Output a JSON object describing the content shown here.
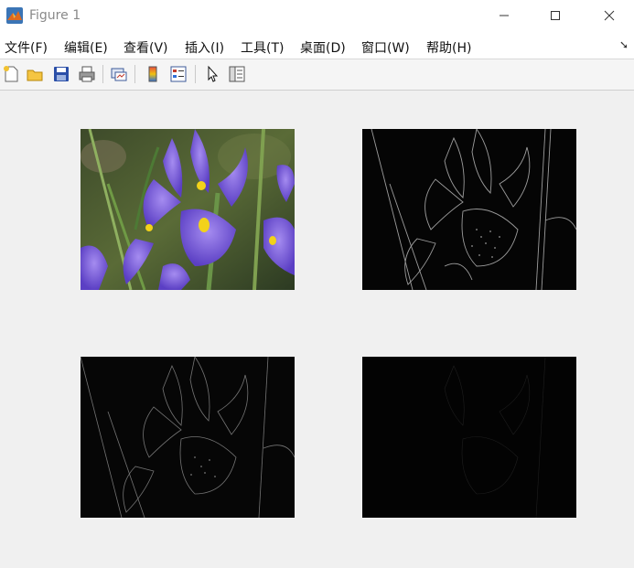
{
  "window": {
    "title": "Figure 1",
    "icon": "matlab-icon",
    "controls": [
      "minimize-icon",
      "maximize-icon",
      "close-icon"
    ]
  },
  "menu": {
    "items": [
      "文件(F)",
      "编辑(E)",
      "查看(V)",
      "插入(I)",
      "工具(T)",
      "桌面(D)",
      "窗口(W)",
      "帮助(H)"
    ],
    "overflow_icon": "dock-arrow-icon"
  },
  "toolbar": {
    "buttons": [
      "new-figure-icon",
      "open-file-icon",
      "save-icon",
      "print-icon",
      "link-plot-icon",
      "colorbar-icon",
      "legend-icon",
      "pointer-icon",
      "property-editor-icon"
    ]
  },
  "figure": {
    "axes": [
      {
        "content": "iris-color-image"
      },
      {
        "content": "edge-map-bright"
      },
      {
        "content": "edge-map-medium"
      },
      {
        "content": "edge-map-dark"
      }
    ]
  },
  "colors": {
    "window_bg": "#f0f0f0",
    "petal": "#7b5ce0",
    "edge_line": "#ffffff",
    "image_bg": "#000000"
  }
}
